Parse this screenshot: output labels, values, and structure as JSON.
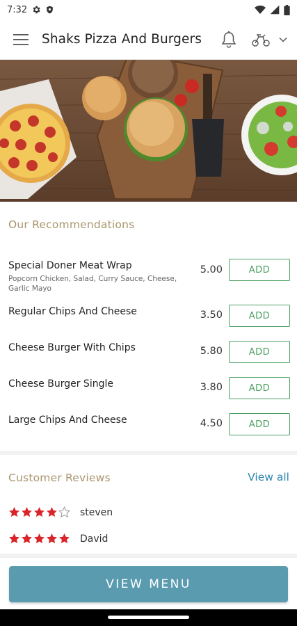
{
  "status_bar": {
    "time": "7:32",
    "icons": [
      "settings-gear-icon",
      "shield-icon",
      "wifi-icon",
      "cellular-signal-icon",
      "battery-icon"
    ]
  },
  "app_bar": {
    "title": "Shaks Pizza And Burgers",
    "icons": [
      "hamburger-menu-icon",
      "bell-icon",
      "scooter-icon",
      "chevron-down-icon"
    ]
  },
  "hero": {
    "image_subject": "pizza, burgers and salad on wooden board"
  },
  "recommendations": {
    "title": "Our Recommendations",
    "add_label": "ADD",
    "items": [
      {
        "name": "Special Doner Meat Wrap",
        "description": "Popcorn Chicken, Salad, Curry Sauce, Cheese, Garlic Mayo",
        "price": "5.00"
      },
      {
        "name": "Regular Chips And Cheese",
        "description": "",
        "price": "3.50"
      },
      {
        "name": "Cheese Burger With Chips",
        "description": "",
        "price": "5.80"
      },
      {
        "name": "Cheese Burger Single",
        "description": "",
        "price": "3.80"
      },
      {
        "name": "Large Chips And Cheese",
        "description": "",
        "price": "4.50"
      }
    ]
  },
  "reviews": {
    "title": "Customer Reviews",
    "view_all_label": "View all",
    "star_color": "#d9252a",
    "items": [
      {
        "name": "steven",
        "rating": 4,
        "max_rating": 5
      },
      {
        "name": "David",
        "rating": 5,
        "max_rating": 5
      }
    ]
  },
  "footer": {
    "view_menu_label": "VIEW MENU",
    "button_color": "#5a9bb0"
  }
}
